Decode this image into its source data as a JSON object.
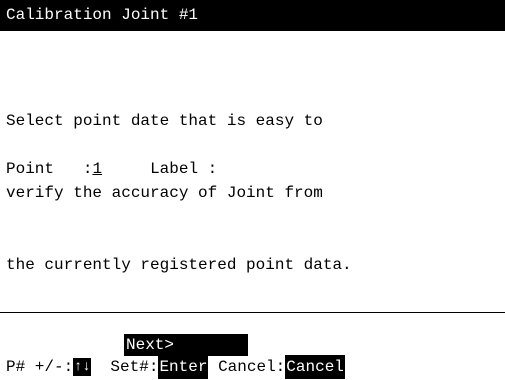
{
  "window": {
    "title": "Calibration Joint #1"
  },
  "instructions": [
    "Select point date that is easy to",
    "verify the accuracy of Joint from",
    "the currently registered point data."
  ],
  "point_field": {
    "label": "Point",
    "separator": ":",
    "value": "1"
  },
  "label_field": {
    "label": "Label :",
    "value": ""
  },
  "softkeys": {
    "next": "Next>",
    "point_number_prefix": "P# +/-:",
    "point_number_key": "↑↓",
    "set_prefix": "Set#:",
    "set_key": "Enter",
    "cancel_prefix": "Cancel:",
    "cancel_key": "Cancel"
  }
}
